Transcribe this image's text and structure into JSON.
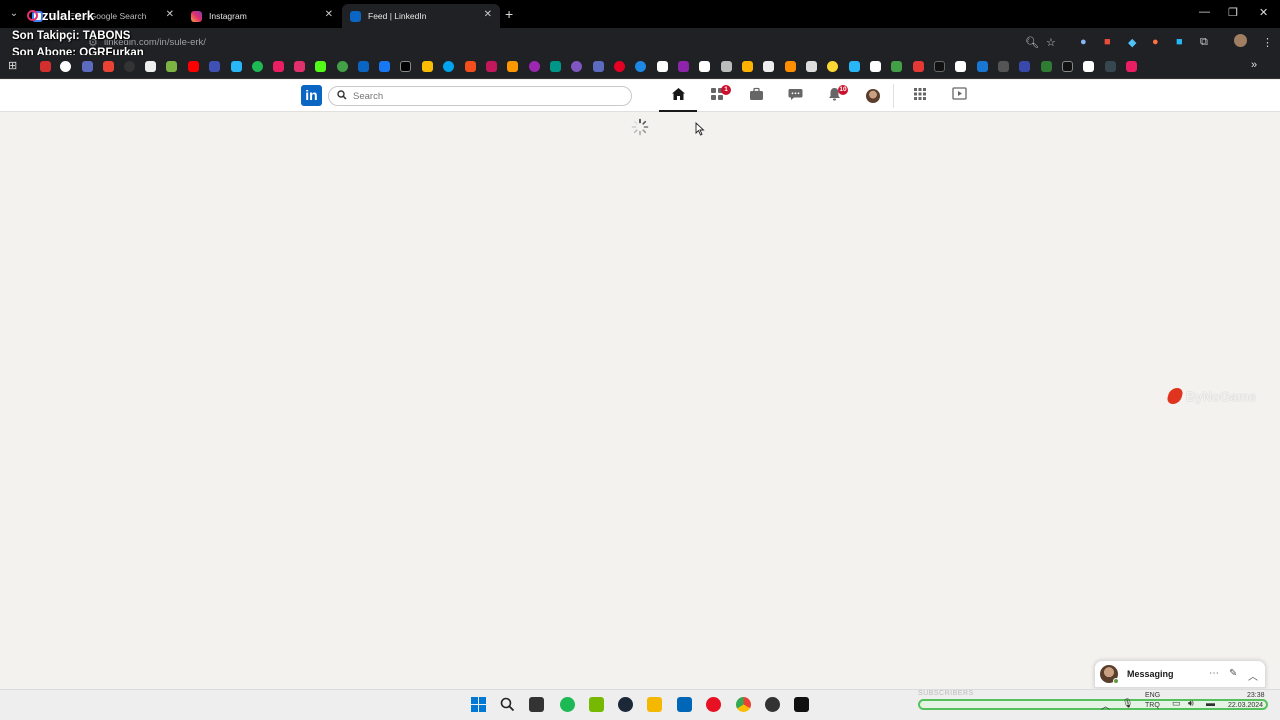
{
  "browser": {
    "tabs": [
      {
        "title": "Şule Erk - Google Search",
        "active": false
      },
      {
        "title": "Instagram",
        "active": false
      },
      {
        "title": "Feed | LinkedIn",
        "active": true
      }
    ],
    "url": "linkedin.com/in/sule-erk/"
  },
  "overlay": {
    "brand": "zulal.erk",
    "last_follower": "Son Takipçi: TABONS",
    "last_subscriber": "Son Abone: OGRFurkan"
  },
  "linkedin": {
    "logo": "in",
    "search_placeholder": "Search",
    "network_badge": "1",
    "notifications_badge": "10"
  },
  "watermark": "ByNoGame",
  "messaging": {
    "label": "Messaging"
  },
  "taskbar": {
    "subscribers_label": "SUBSCRIBERS",
    "lang_top": "ENG",
    "lang_bottom": "TRQ",
    "time": "23:38",
    "date": "22.03.2024"
  },
  "colors": {
    "linkedin_blue": "#0a66c2",
    "badge_red": "#cb112d",
    "page_bg": "#f4f2ee"
  }
}
